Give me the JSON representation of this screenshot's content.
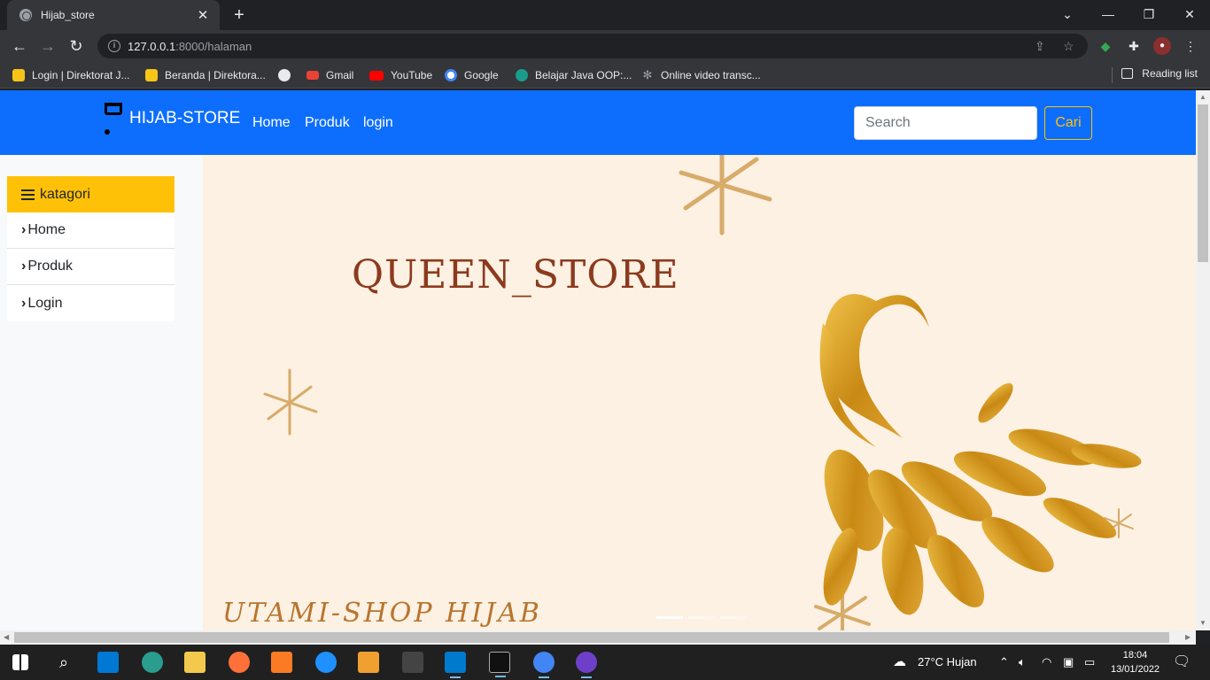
{
  "browser": {
    "tab_title": "Hijab_store",
    "tab_close": "✕",
    "new_tab": "+",
    "url_host": "127.0.0.1",
    "url_path": ":8000/halaman",
    "window_controls": {
      "minimize": "—",
      "restore": "❐",
      "close": "✕",
      "tab_search": "⌄"
    }
  },
  "bookmarks": [
    {
      "label": "Login | Direktorat J...",
      "color": "#f5c518"
    },
    {
      "label": "Beranda | Direktora...",
      "color": "#f5c518"
    },
    {
      "label": "",
      "color": "#e8eaed"
    },
    {
      "label": "Gmail",
      "color": "#ea4335"
    },
    {
      "label": "YouTube",
      "color": "#ff0000"
    },
    {
      "label": "Google",
      "color": "#4285f4"
    },
    {
      "label": "Belajar Java OOP:...",
      "color": "#1a9c8c"
    },
    {
      "label": "Online video transc...",
      "color": "#9aa0a6"
    }
  ],
  "reading_list": "Reading list",
  "navbar": {
    "brand": "HIJAB-STORE",
    "links": [
      "Home",
      "Produk",
      "login"
    ],
    "search_placeholder": "Search",
    "search_button": "Cari",
    "bg": "#0d6efd",
    "accent": "#ffc107"
  },
  "sidebar": {
    "title": "katagori",
    "items": [
      {
        "label": "Home"
      },
      {
        "label": "Produk"
      },
      {
        "label": "Login"
      }
    ]
  },
  "banner": {
    "title": "QUEEN_STORE",
    "subtitle": "UTAMI-SHOP  HIJAB",
    "indicators": 3,
    "active_indicator": 0
  },
  "taskbar": {
    "weather": "27°C  Hujan",
    "time": "18:04",
    "date": "13/01/2022"
  }
}
